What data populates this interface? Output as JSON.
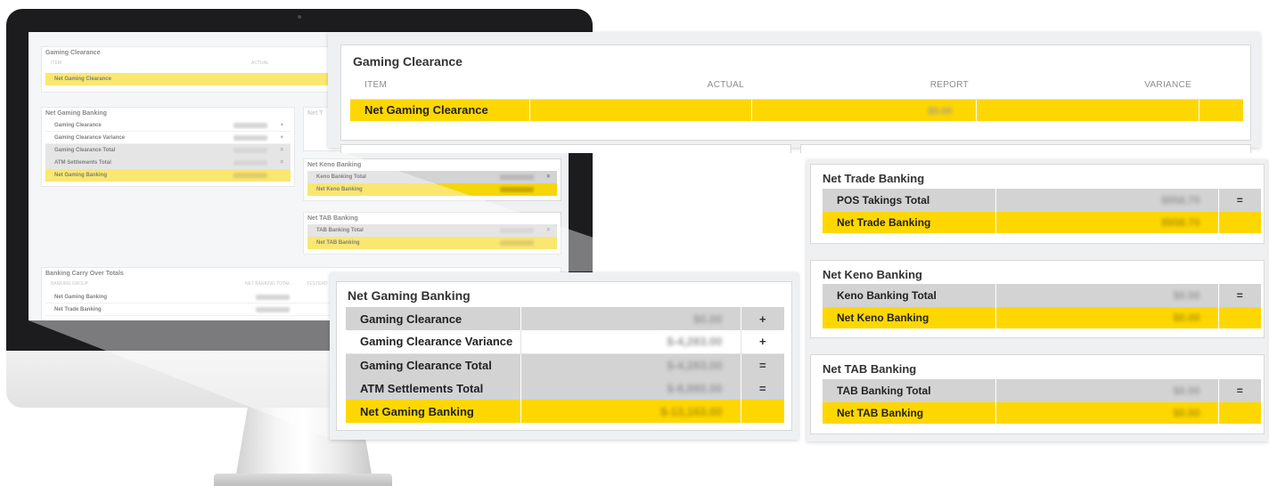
{
  "colors": {
    "highlight_yellow": "#ffd700",
    "row_grey": "#d3d3d3",
    "panel_background": "#eef0f2",
    "text_dark": "#222222"
  },
  "monitor_screen": {
    "gaming_clearance": {
      "title": "Gaming Clearance",
      "col_item": "ITEM",
      "col_actual": "ACTUAL",
      "row": "Net Gaming Clearance"
    },
    "net_gaming_banking": {
      "title": "Net Gaming Banking",
      "rows": [
        "Gaming Clearance",
        "Gaming Clearance Variance",
        "Gaming Clearance Total",
        "ATM Settlements Total",
        "Net Gaming Banking"
      ]
    },
    "net_trade_banking": {
      "title": "Net T"
    },
    "net_keno_banking": {
      "title": "Net Keno Banking",
      "rows": [
        "Keno Banking Total",
        "Net Keno Banking"
      ]
    },
    "net_tab_banking": {
      "title": "Net TAB Banking",
      "rows": [
        "TAB Banking Total",
        "Net TAB Banking"
      ]
    },
    "carry_over": {
      "title": "Banking Carry Over Totals",
      "col_group": "BANKING GROUP",
      "col_total": "NET BANKING TOTAL",
      "col_yesterday": "YESTERD",
      "rows": [
        "Net Gaming Banking",
        "Net Trade Banking"
      ]
    }
  },
  "gaming_clearance": {
    "title": "Gaming Clearance",
    "columns": {
      "item": "ITEM",
      "actual": "ACTUAL",
      "report": "REPORT",
      "variance": "VARIANCE"
    },
    "row": {
      "item": "Net Gaming Clearance",
      "actual": "",
      "report": "$0.00",
      "variance": ""
    }
  },
  "net_gaming_banking": {
    "title": "Net Gaming Banking",
    "rows": [
      {
        "label": "Gaming Clearance",
        "value": "$0.00",
        "op": "+"
      },
      {
        "label": "Gaming Clearance Variance",
        "value": "$-4,283.00",
        "op": "+"
      },
      {
        "label": "Gaming Clearance Total",
        "value": "$-4,283.00",
        "op": "="
      },
      {
        "label": "ATM Settlements Total",
        "value": "$-8,880.00",
        "op": "="
      },
      {
        "label": "Net Gaming Banking",
        "value": "$-13,163.00",
        "op": ""
      }
    ]
  },
  "net_trade_banking": {
    "title": "Net Trade Banking",
    "rows": [
      {
        "label": "POS Takings Total",
        "value": "$958.70",
        "op": "="
      },
      {
        "label": "Net Trade Banking",
        "value": "$958.70",
        "op": ""
      }
    ]
  },
  "net_keno_banking": {
    "title": "Net Keno Banking",
    "rows": [
      {
        "label": "Keno Banking Total",
        "value": "$0.00",
        "op": "="
      },
      {
        "label": "Net Keno Banking",
        "value": "$0.00",
        "op": ""
      }
    ]
  },
  "net_tab_banking": {
    "title": "Net TAB Banking",
    "rows": [
      {
        "label": "TAB Banking Total",
        "value": "$0.00",
        "op": "="
      },
      {
        "label": "Net TAB Banking",
        "value": "$0.00",
        "op": ""
      }
    ]
  }
}
